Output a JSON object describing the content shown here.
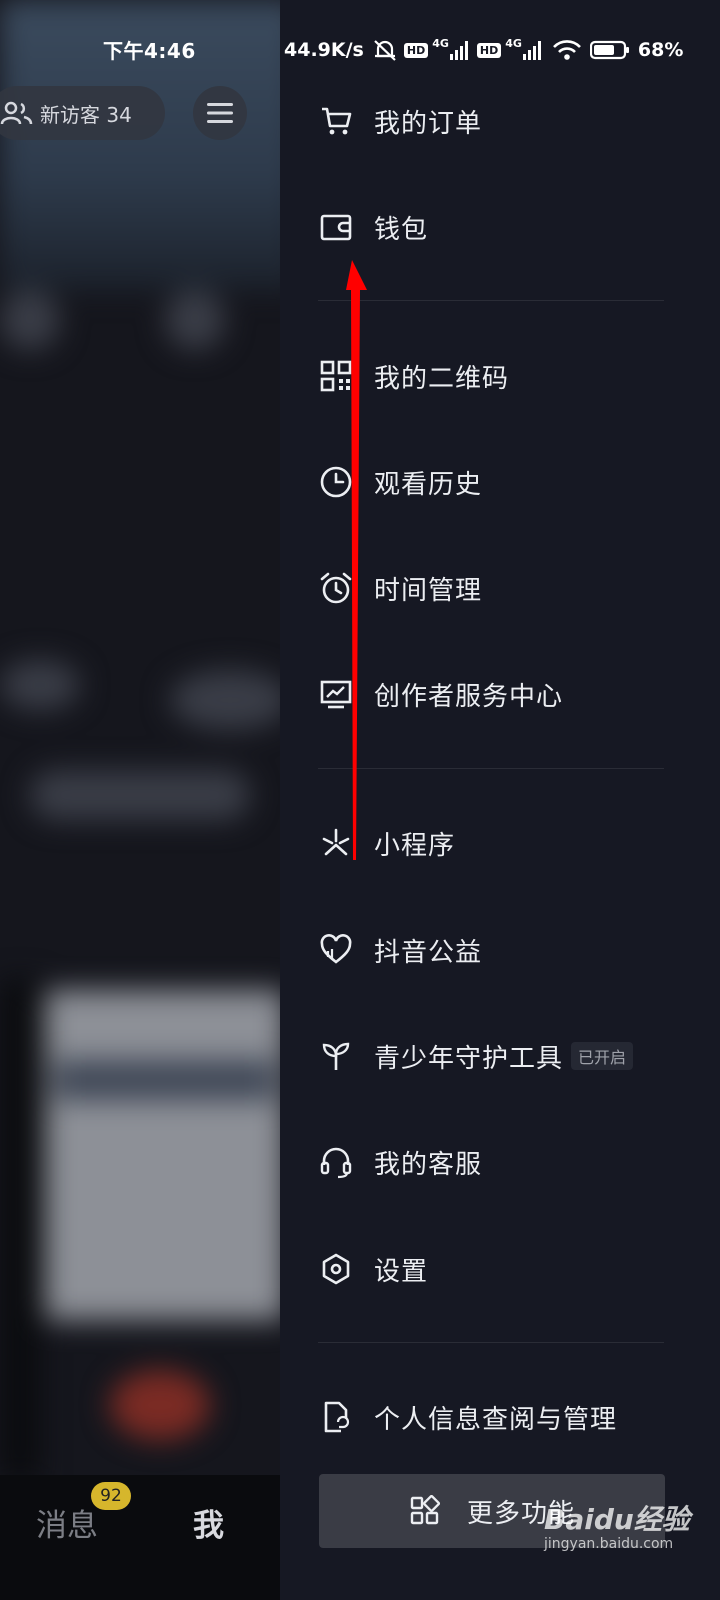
{
  "status_bar": {
    "time": "下午4:46",
    "net_speed": "44.9K/s",
    "net1": "4G",
    "net2": "4G",
    "hd": "HD",
    "battery": "68%"
  },
  "background_profile": {
    "visitor_label": "新访客 34",
    "tabs": {
      "messages": "消息",
      "me": "我"
    },
    "message_badge": "92"
  },
  "drawer": {
    "items": [
      {
        "label": "我的订单",
        "icon": "cart-icon"
      },
      {
        "label": "钱包",
        "icon": "wallet-icon"
      },
      {
        "label": "我的二维码",
        "icon": "qrcode-icon"
      },
      {
        "label": "观看历史",
        "icon": "clock-icon"
      },
      {
        "label": "时间管理",
        "icon": "alarm-icon"
      },
      {
        "label": "创作者服务中心",
        "icon": "creator-chart-icon"
      },
      {
        "label": "小程序",
        "icon": "mini-program-icon"
      },
      {
        "label": "抖音公益",
        "icon": "charity-heart-icon"
      },
      {
        "label": "青少年守护工具",
        "icon": "sprout-icon",
        "tag": "已开启"
      },
      {
        "label": "我的客服",
        "icon": "headset-icon"
      },
      {
        "label": "设置",
        "icon": "settings-hexagon-icon"
      },
      {
        "label": "个人信息查阅与管理",
        "icon": "document-icon"
      }
    ],
    "more_button": "更多功能"
  },
  "annotation": {
    "arrow_color": "#ff0000"
  },
  "watermark": {
    "brand": "Baidu经验",
    "url": "jingyan.baidu.com"
  }
}
